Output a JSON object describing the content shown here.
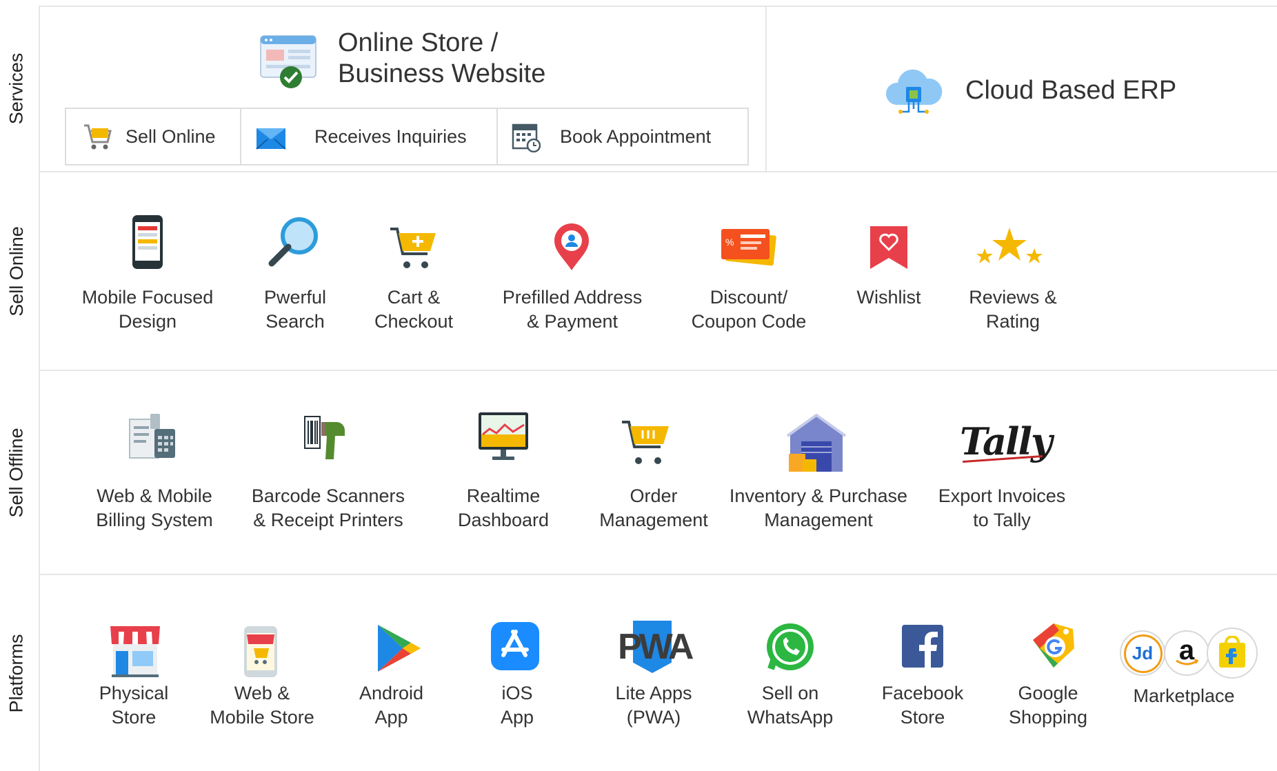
{
  "rows": {
    "services": "Services",
    "sell_online": "Sell Online",
    "sell_offline": "Sell Offline",
    "platforms": "Platforms"
  },
  "services": {
    "title": "Online Store /\nBusiness Website",
    "erp": "Cloud Based ERP",
    "sub": [
      "Sell Online",
      "Receives Inquiries",
      "Book Appointment"
    ]
  },
  "sell_online": [
    {
      "label": "Mobile Focused\nDesign",
      "icon": "mobile-phone-icon"
    },
    {
      "label": "Pwerful\nSearch",
      "icon": "magnifier-icon"
    },
    {
      "label": "Cart &\nCheckout",
      "icon": "cart-add-icon"
    },
    {
      "label": "Prefilled Address\n& Payment",
      "icon": "location-pin-icon"
    },
    {
      "label": "Discount/\nCoupon Code",
      "icon": "coupon-icon"
    },
    {
      "label": "Wishlist",
      "icon": "wishlist-bookmark-icon"
    },
    {
      "label": "Reviews &\nRating",
      "icon": "stars-icon"
    }
  ],
  "sell_offline": [
    {
      "label": "Web & Mobile\nBilling System",
      "icon": "billing-icon"
    },
    {
      "label": "Barcode Scanners\n& Receipt Printers",
      "icon": "barcode-scanner-icon"
    },
    {
      "label": "Realtime\nDashboard",
      "icon": "dashboard-monitor-icon"
    },
    {
      "label": "Order\nManagement",
      "icon": "order-cart-icon"
    },
    {
      "label": "Inventory & Purchase\nManagement",
      "icon": "warehouse-icon"
    },
    {
      "label": "Export Invoices\nto Tally",
      "icon": "tally-logo",
      "logo_text": "Tally"
    }
  ],
  "platforms": [
    {
      "label": "Physical\nStore",
      "icon": "physical-store-icon"
    },
    {
      "label": "Web &\nMobile Store",
      "icon": "mobile-store-icon"
    },
    {
      "label": "Android\nApp",
      "icon": "google-play-icon"
    },
    {
      "label": "iOS\nApp",
      "icon": "app-store-icon"
    },
    {
      "label": "Lite Apps\n(PWA)",
      "icon": "pwa-logo",
      "logo_text": "PWA"
    },
    {
      "label": "Sell on\nWhatsApp",
      "icon": "whatsapp-icon"
    },
    {
      "label": "Facebook\nStore",
      "icon": "facebook-icon"
    },
    {
      "label": "Google\nShopping",
      "icon": "google-shopping-icon"
    },
    {
      "label": "Marketplace",
      "icon": "marketplace-logos-icon",
      "logos": [
        "Jd",
        "a"
      ]
    }
  ],
  "colors": {
    "border": "#e6e6e6",
    "text": "#333333",
    "red": "#e8404a",
    "orange": "#f5b800",
    "blue": "#1e88e5"
  }
}
